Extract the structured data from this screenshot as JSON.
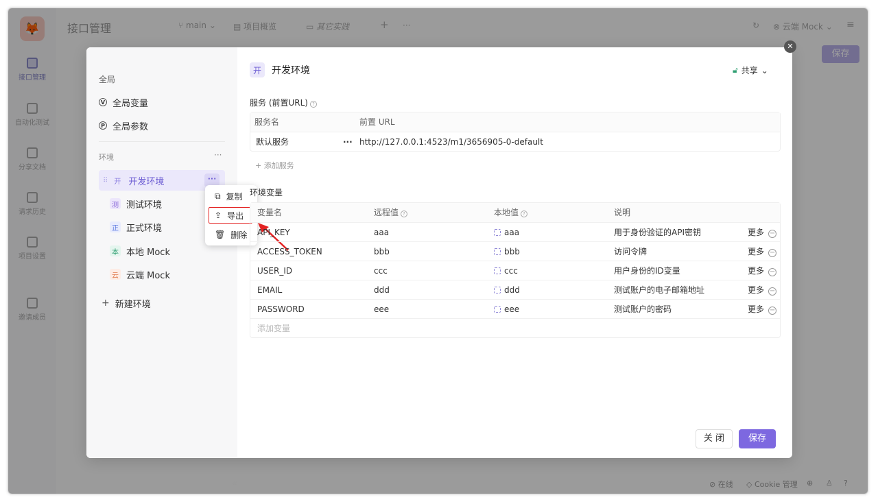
{
  "app": {
    "title": "接口管理",
    "branch": "main",
    "tabs": [
      "项目概览",
      "其它实践"
    ],
    "env_selector": "云端 Mock",
    "save_label": "保存"
  },
  "rail": {
    "items": [
      "接口管理",
      "自动化测试",
      "分享文档",
      "请求历史",
      "项目设置",
      "邀请成员"
    ]
  },
  "status_bar": {
    "online": "在线",
    "cookie": "Cookie 管理"
  },
  "sidebar": {
    "global_title": "全局",
    "global_vars": "全局变量",
    "global_params": "全局参数",
    "env_title": "环境",
    "env_more": "···",
    "envs": [
      {
        "tag": "开",
        "name": "开发环境",
        "bg": "#ebe8fb",
        "fg": "#6d5dd3"
      },
      {
        "tag": "测",
        "name": "测试环境",
        "bg": "#ece6fb",
        "fg": "#8b6ad8"
      },
      {
        "tag": "正",
        "name": "正式环境",
        "bg": "#e8ecfd",
        "fg": "#5b78e0"
      },
      {
        "tag": "本",
        "name": "本地 Mock",
        "bg": "#e4f5ee",
        "fg": "#2f9f72"
      },
      {
        "tag": "云",
        "name": "云端 Mock",
        "bg": "#fdece5",
        "fg": "#e07a4e"
      }
    ],
    "new_env": "新建环境",
    "row_more": "···"
  },
  "context_menu": {
    "copy": "复制",
    "export": "导出",
    "delete": "删除"
  },
  "main": {
    "env_tag": "开",
    "env_name": "开发环境",
    "share": "共享",
    "services_label": "服务 (前置URL)",
    "services_headers": [
      "服务名",
      "前置 URL"
    ],
    "services": [
      {
        "name": "默认服务",
        "url": "http://127.0.0.1:4523/m1/3656905-0-default"
      }
    ],
    "add_service": "+ 添加服务",
    "vars_label": "环境变量",
    "vars_headers": [
      "变量名",
      "远程值",
      "本地值",
      "说明"
    ],
    "vars": [
      {
        "name": "API_KEY",
        "remote": "aaa",
        "local": "aaa",
        "desc": "用于身份验证的API密钥"
      },
      {
        "name": "ACCESS_TOKEN",
        "remote": "bbb",
        "local": "bbb",
        "desc": "访问令牌"
      },
      {
        "name": "USER_ID",
        "remote": "ccc",
        "local": "ccc",
        "desc": "用户身份的ID变量"
      },
      {
        "name": "EMAIL",
        "remote": "ddd",
        "local": "ddd",
        "desc": "测试账户的电子邮箱地址"
      },
      {
        "name": "PASSWORD",
        "remote": "eee",
        "local": "eee",
        "desc": "测试账户的密码"
      }
    ],
    "more_label": "更多",
    "add_var_placeholder": "添加变量",
    "close_label": "关 闭",
    "save_label": "保存"
  }
}
